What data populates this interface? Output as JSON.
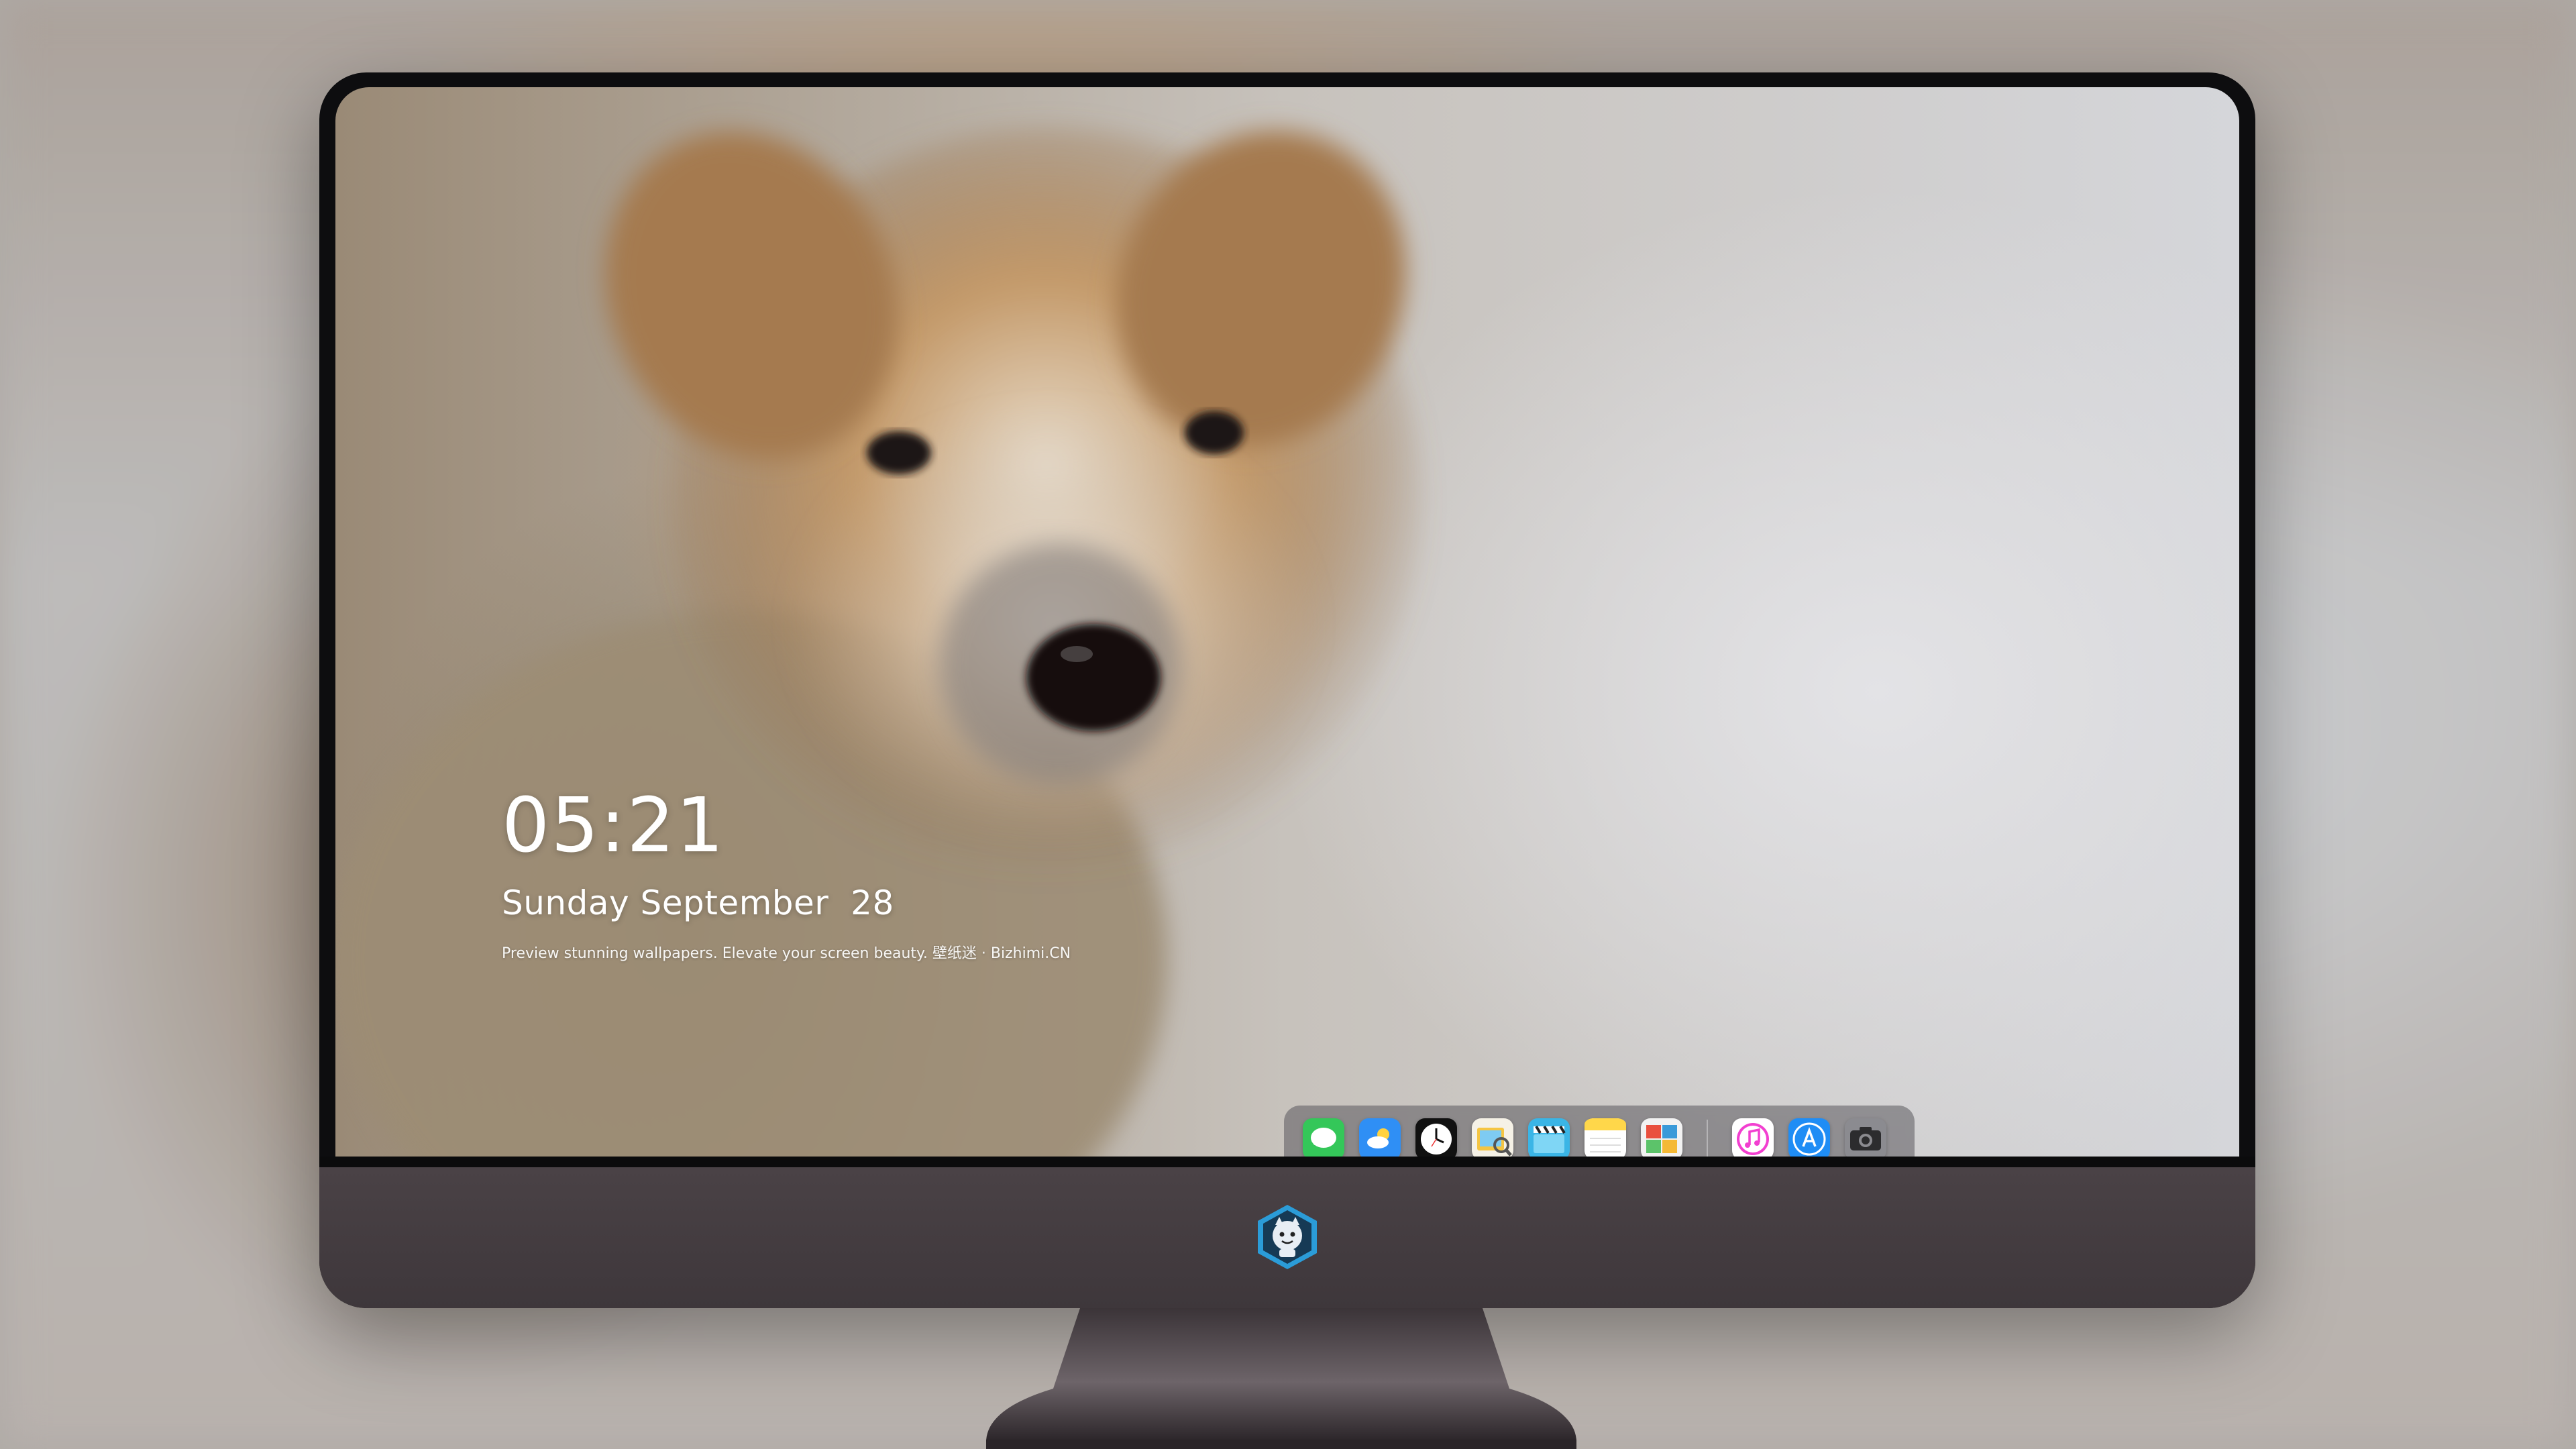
{
  "lockscreen": {
    "time": "05:21",
    "date": "Sunday September  28",
    "caption": "Preview stunning wallpapers. Elevate your screen beauty. 壁纸迷 · Bizhimi.CN"
  },
  "dock": {
    "apps": [
      {
        "icon": "messages-icon",
        "color": "#34c759"
      },
      {
        "icon": "weather-icon",
        "color": "#2f8ff5"
      },
      {
        "icon": "clock-icon",
        "color": "#111111"
      },
      {
        "icon": "preview-icon",
        "color": "#f5c542"
      },
      {
        "icon": "clips-icon",
        "color": "#3ab5e6"
      },
      {
        "icon": "notes-icon",
        "color": "#ffd74a"
      },
      {
        "icon": "photo-booth-icon",
        "color": "#e9503f"
      }
    ],
    "pinned": [
      {
        "icon": "music-icon",
        "color": "#f23fd0"
      },
      {
        "icon": "app-store-icon",
        "color": "#1f8df5"
      },
      {
        "icon": "camera-icon",
        "color": "#8b8b90"
      }
    ]
  },
  "chin": {
    "logo": "monster-mascot-logo"
  }
}
